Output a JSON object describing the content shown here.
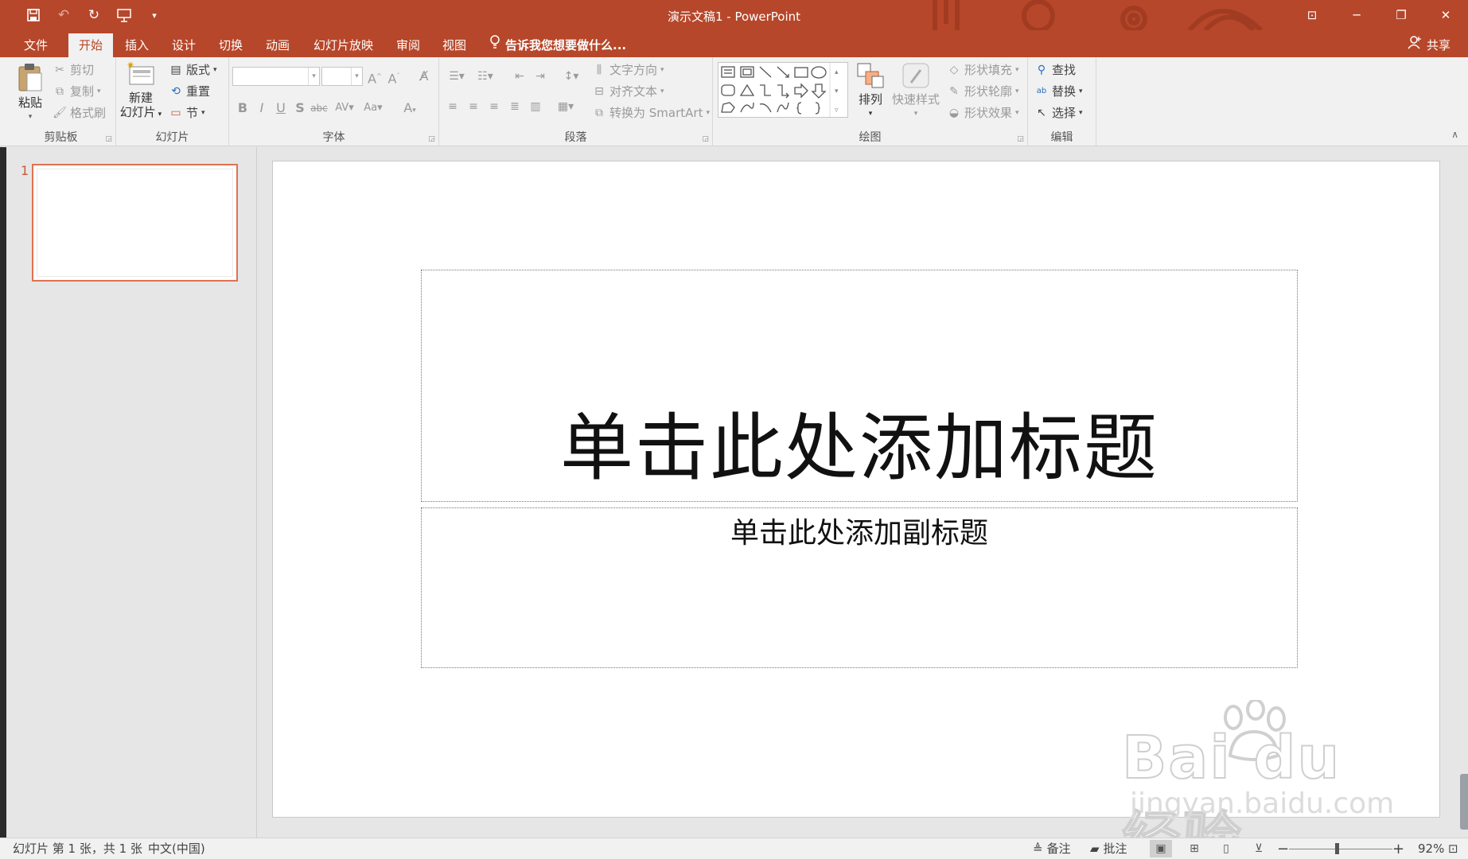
{
  "app": {
    "window_title": "演示文稿1 - PowerPoint"
  },
  "tabs": [
    {
      "label": "文件",
      "active": false
    },
    {
      "label": "开始",
      "active": true
    },
    {
      "label": "插入",
      "active": false
    },
    {
      "label": "设计",
      "active": false
    },
    {
      "label": "切换",
      "active": false
    },
    {
      "label": "动画",
      "active": false
    },
    {
      "label": "幻灯片放映",
      "active": false
    },
    {
      "label": "审阅",
      "active": false
    },
    {
      "label": "视图",
      "active": false
    }
  ],
  "tellme": "告诉我您想要做什么...",
  "share": "共享",
  "ribbon": {
    "clipboard": {
      "label": "剪贴板",
      "paste": "粘贴",
      "cut": "剪切",
      "copy": "复制",
      "format_painter": "格式刷"
    },
    "slides": {
      "label": "幻灯片",
      "new_slide_line1": "新建",
      "new_slide_line2": "幻灯片",
      "layout": "版式",
      "reset": "重置",
      "section": "节"
    },
    "font": {
      "label": "字体",
      "font_name": "",
      "font_size": ""
    },
    "paragraph": {
      "label": "段落",
      "text_direction": "文字方向",
      "align_text": "对齐文本",
      "convert_smartart": "转换为 SmartArt"
    },
    "drawing": {
      "label": "绘图",
      "arrange": "排列",
      "quick_styles": "快速样式",
      "shape_fill": "形状填充",
      "shape_outline": "形状轮廓",
      "shape_effects": "形状效果"
    },
    "editing": {
      "label": "编辑",
      "find": "查找",
      "replace": "替换",
      "select": "选择"
    }
  },
  "thumbnails": [
    {
      "number": "1"
    }
  ],
  "slide": {
    "title_placeholder": "单击此处添加标题",
    "subtitle_placeholder": "单击此处添加副标题"
  },
  "watermark": {
    "brand": "Bai du 经验",
    "url": "jingyan.baidu.com"
  },
  "statusbar": {
    "slide_info": "幻灯片 第 1 张，共 1 张",
    "language": "中文(中国)",
    "notes": "备注",
    "comments": "批注",
    "zoom": "92%"
  },
  "colors": {
    "accent": "#b7472a",
    "selection": "#e0724f"
  }
}
